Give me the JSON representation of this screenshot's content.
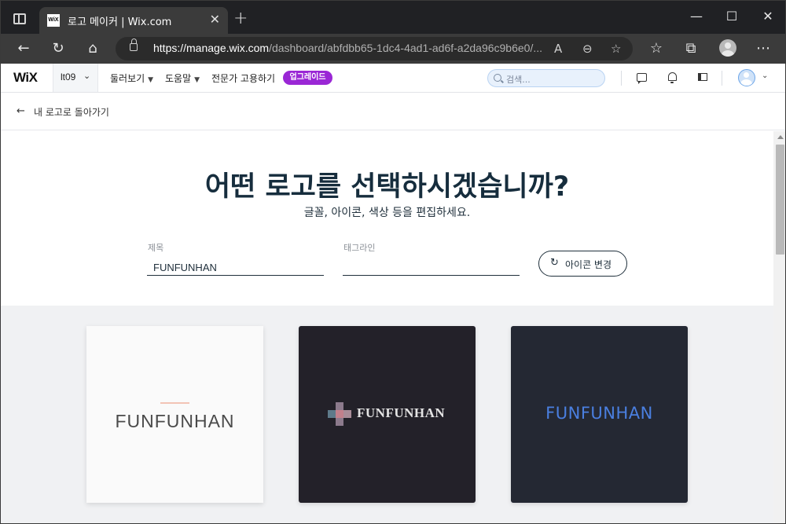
{
  "browser": {
    "tab_title": "로고 메이커 | Wix.com",
    "tab_favicon_text": "WiX",
    "close_tab": "✕",
    "new_tab": "+",
    "window_controls": {
      "minimize": "—",
      "maximize": "☐",
      "close": "✕"
    },
    "url_host": "https://manage.wix.com",
    "url_path": "/dashboard/abfdbb65-1dc4-4ad1-ad6f-a2da96c9b6e0/...",
    "icons": [
      "back-icon",
      "refresh-icon",
      "home-icon",
      "lock-icon",
      "read-aloud-icon",
      "zoom-out-icon",
      "add-favorite-icon",
      "favorites-icon",
      "collections-icon",
      "profile-icon",
      "more-icon"
    ]
  },
  "wix_header": {
    "logo": "WiX",
    "site_name": "lt09",
    "menu": [
      "둘러보기",
      "도움말",
      "전문가 고용하기"
    ],
    "upgrade": "업그레이드",
    "search_placeholder": "검색..."
  },
  "back_link": "내 로고로 돌아가기",
  "main": {
    "headline": "어떤 로고를 선택하시겠습니까?",
    "subline": "글꼴, 아이콘, 색상 등을 편집하세요.",
    "title_label": "제목",
    "title_value": "FUNFUNHAN",
    "tagline_label": "태그라인",
    "tagline_value": "",
    "change_icon_button": "아이콘 변경",
    "logos": [
      {
        "text": "FUNFUNHAN",
        "background": "#fafafa",
        "text_color": "#4a4a4a",
        "accent": "#f2c4b5"
      },
      {
        "text": "FUNFUNHAN",
        "background": "#232129",
        "text_color": "#e4e4e4"
      },
      {
        "text": "FUNFUNHAN",
        "background": "#242833",
        "text_color": "#4a7fe0"
      }
    ]
  },
  "colors": {
    "upgrade": "#9a27d5",
    "heading": "#162d3d",
    "search_bg": "#e8f1fc"
  }
}
